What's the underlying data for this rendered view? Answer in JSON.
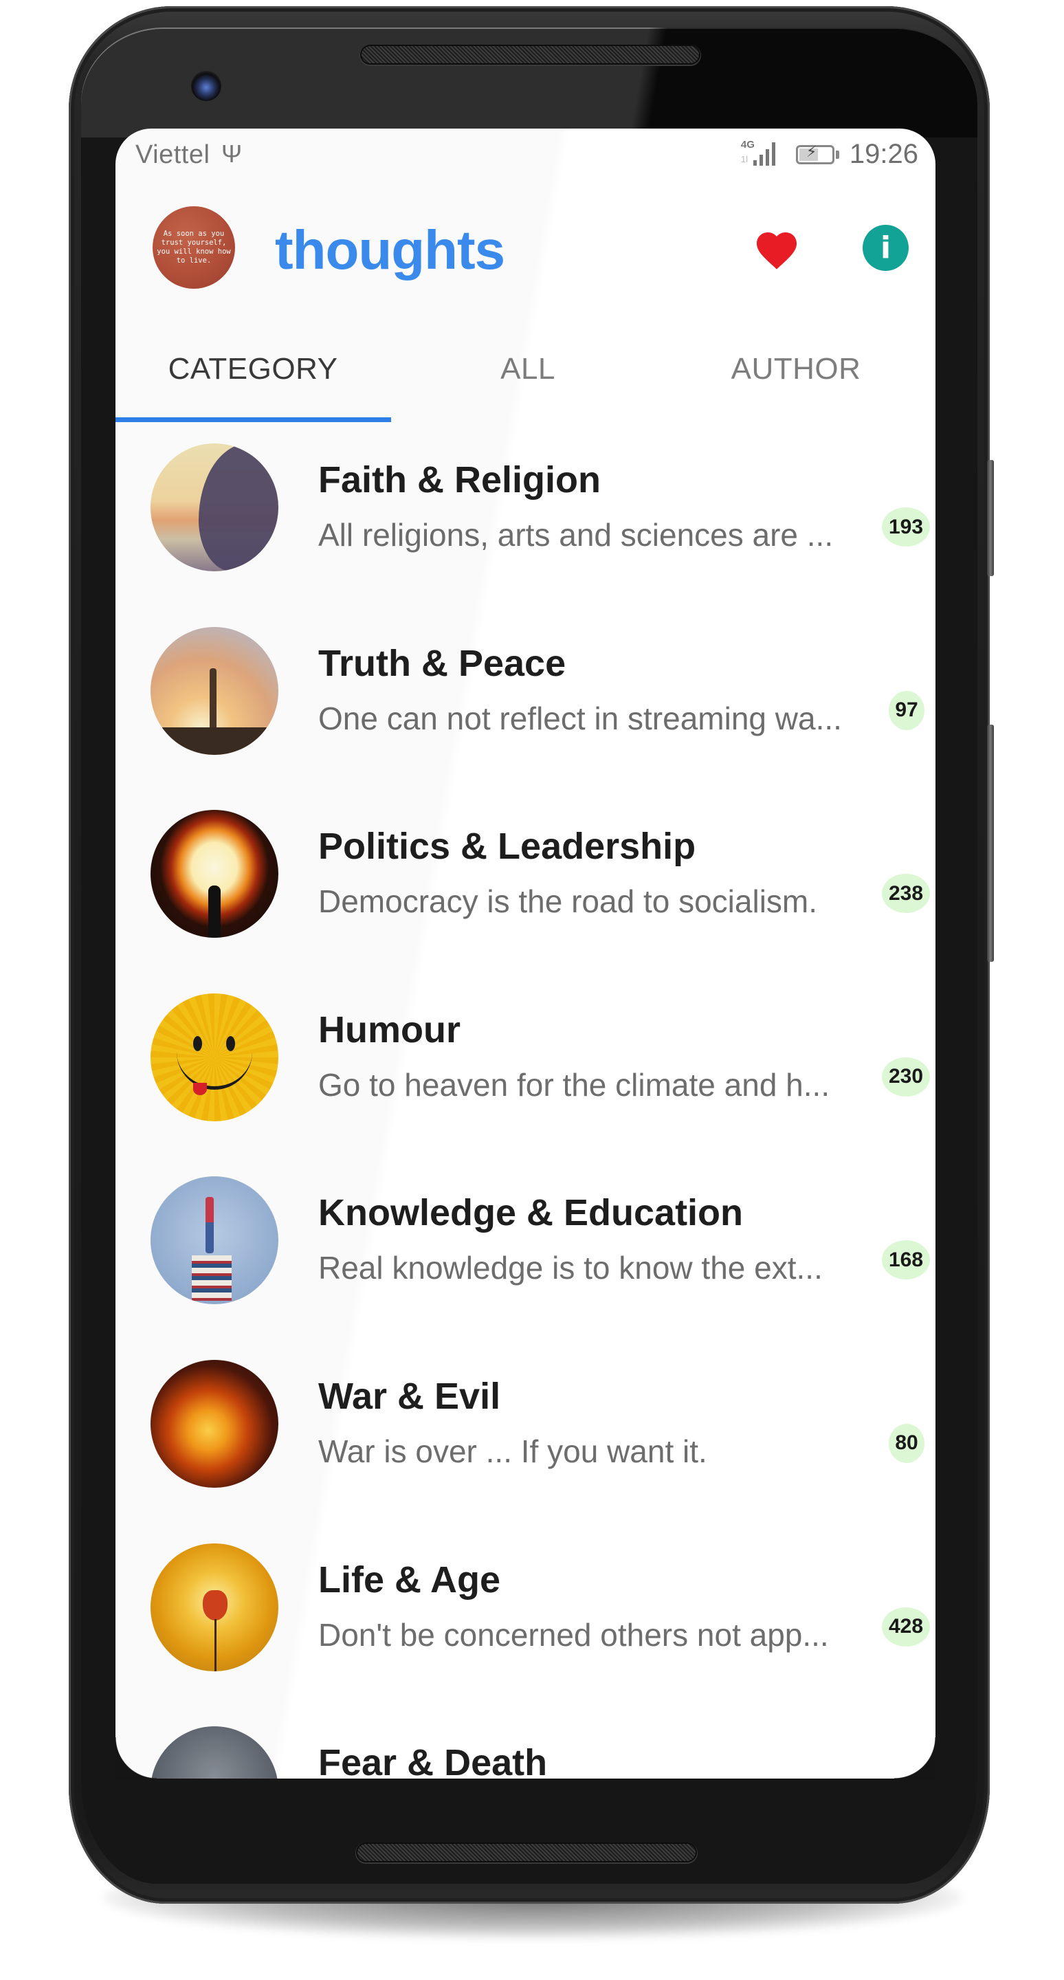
{
  "status_bar": {
    "carrier": "Viettel",
    "usb_icon": "usb-icon",
    "network_label": "4G",
    "network_sub": "1l",
    "signal_icon": "signal-bars-icon",
    "battery_icon": "battery-charging-icon",
    "time": "19:26"
  },
  "header": {
    "logo_text": "As soon as you trust yourself, you will know how to live.",
    "title": "thoughts",
    "favorites_icon": "heart-icon",
    "info_icon": "info-icon",
    "info_glyph": "i",
    "colors": {
      "title": "#3a8df0",
      "heart": "#e81c24",
      "info": "#12a396"
    }
  },
  "tabs": {
    "items": [
      {
        "label": "CATEGORY",
        "active": true
      },
      {
        "label": "ALL",
        "active": false
      },
      {
        "label": "AUTHOR",
        "active": false
      }
    ],
    "indicator_color": "#2f80ed"
  },
  "categories": [
    {
      "title": "Faith & Religion",
      "preview": "All religions, arts and sciences are ...",
      "count": "193",
      "image": "praying-silhouette"
    },
    {
      "title": "Truth & Peace",
      "preview": "One can not reflect in streaming wa...",
      "count": "97",
      "image": "birds-sunset"
    },
    {
      "title": "Politics & Leadership",
      "preview": "Democracy is the road to socialism.",
      "count": "238",
      "image": "lightbulb-doorway"
    },
    {
      "title": "Humour",
      "preview": "Go to heaven for the climate and h...",
      "count": "230",
      "image": "smiley-face"
    },
    {
      "title": "Knowledge & Education",
      "preview": "Real knowledge is to know the ext...",
      "count": "168",
      "image": "books-telescope"
    },
    {
      "title": "War & Evil",
      "preview": "War is over ... If you want it.",
      "count": "80",
      "image": "fire"
    },
    {
      "title": "Life & Age",
      "preview": "Don't be concerned others not app...",
      "count": "428",
      "image": "poppy-sunset"
    },
    {
      "title": "Fear & Death",
      "preview": "",
      "count": "",
      "image": "gray-mist"
    }
  ],
  "badge_color": "#dcf7d3"
}
